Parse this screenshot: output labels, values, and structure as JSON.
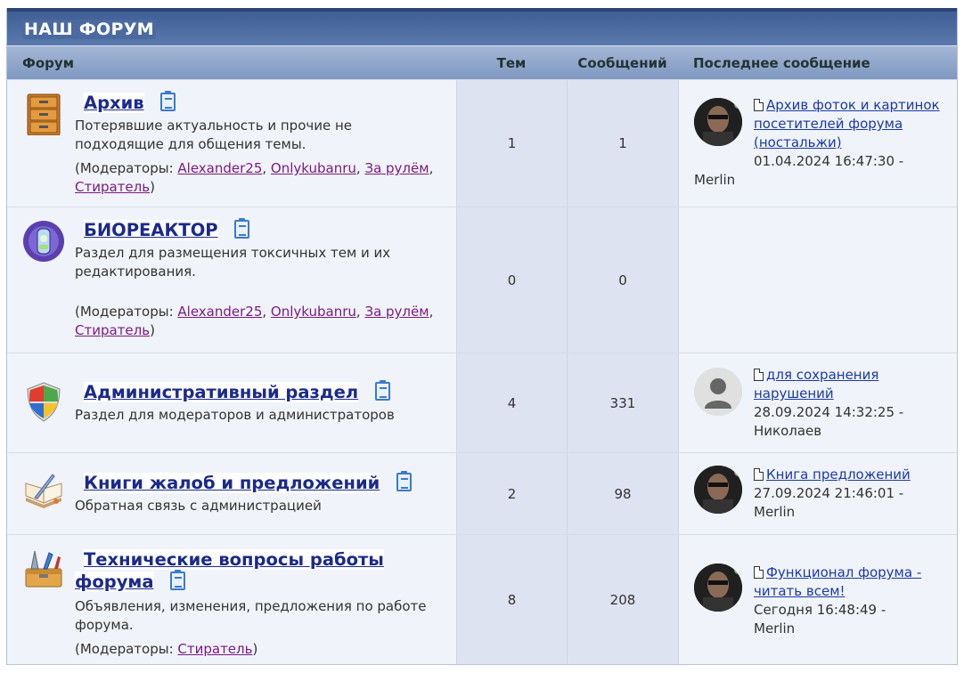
{
  "title": "НАШ ФОРУМ",
  "headers": {
    "forum": "Форум",
    "topics": "Тем",
    "posts": "Сообщений",
    "last": "Последнее сообщение"
  },
  "forums": [
    {
      "name": "Архив",
      "desc": "Потерявшие актуальность и прочие не подходящие для общения темы.",
      "mods_label": "(Модераторы: ",
      "mods": [
        "Alexander25",
        "Onlykubanru",
        "За рулём",
        "Стиратель"
      ],
      "mods_end": ")",
      "topics": "1",
      "posts": "1",
      "last_title": "Архив фоток и картинок посетителей форума (ностальжи)",
      "last_date": "01.04.2024 16:47:30 -",
      "last_user": "Merlin"
    },
    {
      "name": "БИОРЕАКТОР",
      "desc": "Раздел для размещения токсичных тем и их редактирования.",
      "mods_label": "(Модераторы: ",
      "mods": [
        "Alexander25",
        "Onlykubanru",
        "За рулём",
        "Стиратель"
      ],
      "mods_end": ")",
      "topics": "0",
      "posts": "0"
    },
    {
      "name": "Административный раздел",
      "desc": "Раздел для модераторов и администраторов",
      "topics": "4",
      "posts": "331",
      "last_title": "для сохранения нарушений",
      "last_date": "28.09.2024 14:32:25 -",
      "last_user": "Николаев"
    },
    {
      "name": "Книги жалоб и предложений",
      "desc": "Обратная связь с администрацией",
      "topics": "2",
      "posts": "98",
      "last_title": "Книга предложений",
      "last_date": "27.09.2024 21:46:01 -",
      "last_user": "Merlin"
    },
    {
      "name": "Технические вопросы работы форума",
      "desc": "Объявления, изменения, предложения по работе форума.",
      "mods_label": "(Модераторы: ",
      "mods": [
        "Стиратель"
      ],
      "mods_end": ")",
      "topics": "8",
      "posts": "208",
      "last_title": "Функционал форума - читать всем!",
      "last_date": "Сегодня 16:48:49 -",
      "last_user": "Merlin"
    }
  ],
  "icons": [
    "archive-cabinet-icon",
    "bioreactor-icon",
    "shield-icon",
    "book-quill-icon",
    "toolbox-icon"
  ]
}
